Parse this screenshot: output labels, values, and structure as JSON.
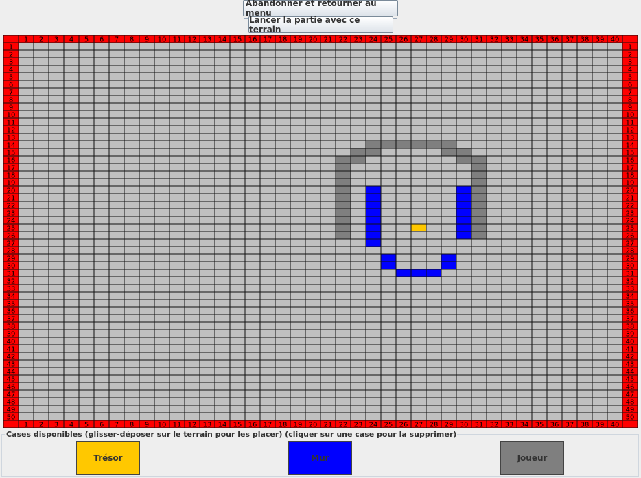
{
  "toolbar": {
    "abandon_label": "Abandonner et retourner au menu",
    "launch_label": "Lancer la partie avec ce terrain"
  },
  "grid": {
    "columns": 40,
    "rows": 50,
    "colors": {
      "header": "#ff0000",
      "header_text": "#000000",
      "empty": "#c0c0c0",
      "cell_border": "#111111",
      "wall": "#0000ff",
      "player": "#7f7f7f",
      "treasure": "#ffc800"
    },
    "cells": {
      "player": [
        [
          14,
          24
        ],
        [
          14,
          25
        ],
        [
          14,
          26
        ],
        [
          14,
          27
        ],
        [
          14,
          28
        ],
        [
          14,
          29
        ],
        [
          15,
          23
        ],
        [
          15,
          24
        ],
        [
          15,
          29
        ],
        [
          15,
          30
        ],
        [
          16,
          22
        ],
        [
          16,
          23
        ],
        [
          16,
          30
        ],
        [
          16,
          31
        ],
        [
          17,
          22
        ],
        [
          17,
          31
        ],
        [
          18,
          22
        ],
        [
          18,
          31
        ],
        [
          19,
          22
        ],
        [
          19,
          31
        ],
        [
          20,
          22
        ],
        [
          20,
          31
        ],
        [
          21,
          22
        ],
        [
          21,
          31
        ],
        [
          22,
          22
        ],
        [
          22,
          31
        ],
        [
          23,
          22
        ],
        [
          23,
          31
        ],
        [
          24,
          22
        ],
        [
          24,
          31
        ],
        [
          25,
          22
        ],
        [
          25,
          31
        ],
        [
          26,
          22
        ],
        [
          26,
          31
        ]
      ],
      "wall": [
        [
          20,
          24
        ],
        [
          20,
          30
        ],
        [
          21,
          24
        ],
        [
          21,
          30
        ],
        [
          22,
          24
        ],
        [
          22,
          30
        ],
        [
          23,
          24
        ],
        [
          23,
          30
        ],
        [
          24,
          24
        ],
        [
          24,
          30
        ],
        [
          25,
          24
        ],
        [
          25,
          30
        ],
        [
          26,
          24
        ],
        [
          26,
          30
        ],
        [
          27,
          24
        ],
        [
          29,
          25
        ],
        [
          29,
          29
        ],
        [
          30,
          25
        ],
        [
          30,
          29
        ],
        [
          31,
          26
        ],
        [
          31,
          27
        ],
        [
          31,
          28
        ]
      ],
      "treasure": [
        [
          25,
          27
        ]
      ]
    }
  },
  "palette": {
    "title": "Cases disponibles (glisser-déposer sur le terrain pour les placer) (cliquer sur une case pour la supprimer)",
    "tiles": [
      {
        "label": "Trésor",
        "color": "#ffc800"
      },
      {
        "label": "Mur",
        "color": "#0000ff"
      },
      {
        "label": "Joueur",
        "color": "#7f7f7f"
      }
    ]
  }
}
